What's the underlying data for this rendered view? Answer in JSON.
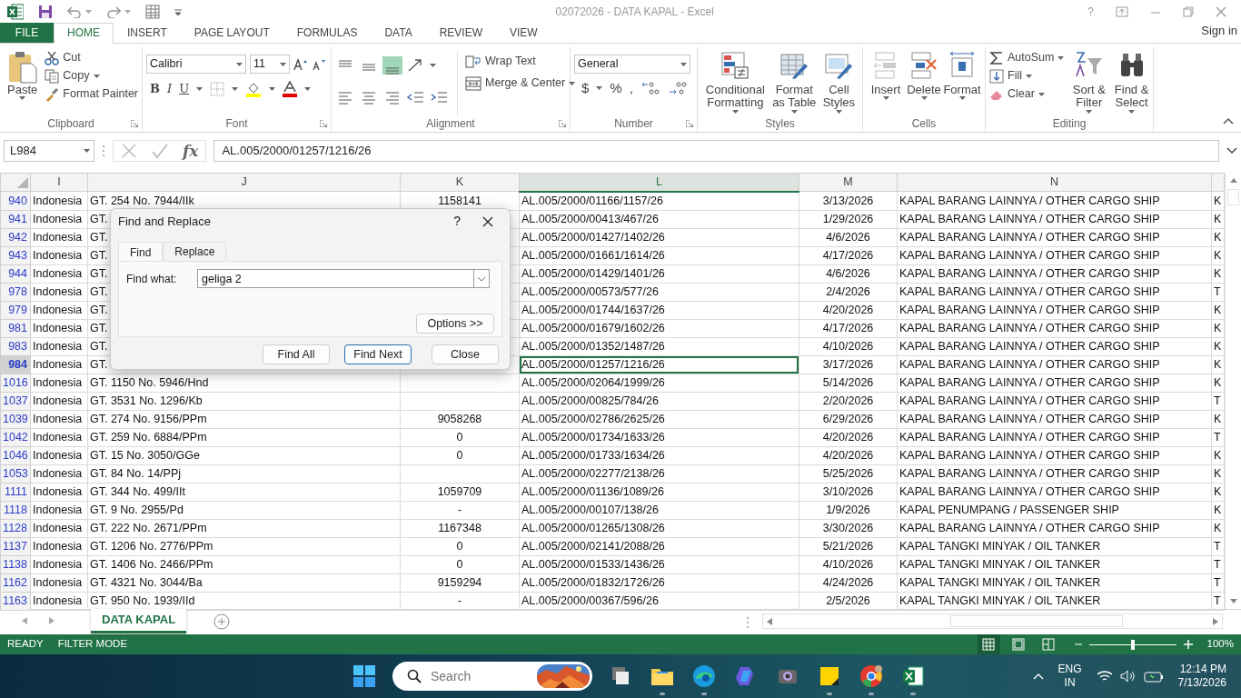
{
  "window": {
    "title": "02072026 - DATA KAPAL - Excel",
    "help": "?"
  },
  "ribbon_tabs": [
    {
      "label": "FILE",
      "kind": "file",
      "selected": false
    },
    {
      "label": "HOME",
      "kind": "tab",
      "selected": true
    },
    {
      "label": "INSERT",
      "kind": "tab",
      "selected": false
    },
    {
      "label": "PAGE LAYOUT",
      "kind": "tab",
      "selected": false
    },
    {
      "label": "FORMULAS",
      "kind": "tab",
      "selected": false
    },
    {
      "label": "DATA",
      "kind": "tab",
      "selected": false
    },
    {
      "label": "REVIEW",
      "kind": "tab",
      "selected": false
    },
    {
      "label": "VIEW",
      "kind": "tab",
      "selected": false
    }
  ],
  "account": "Sign in",
  "ribbon": {
    "groups": [
      {
        "label": "Clipboard",
        "items": [
          {
            "label": "Paste"
          },
          {
            "label": "Cut"
          },
          {
            "label": "Copy"
          },
          {
            "label": "Format Painter"
          }
        ]
      },
      {
        "label": "Font",
        "font": "Calibri",
        "size": "11",
        "styles": [
          "B",
          "I",
          "U"
        ]
      },
      {
        "label": "Alignment",
        "aligns": [
          {
            "selected": false
          },
          {
            "selected": false
          },
          {
            "selected": true
          }
        ],
        "items": [
          {
            "label": "Wrap Text"
          },
          {
            "label": "Merge & Center"
          }
        ]
      },
      {
        "label": "Number",
        "format": "General",
        "symbols": [
          "$",
          "%",
          ","
        ]
      },
      {
        "label": "Styles",
        "items": [
          {
            "label": "Conditional Formatting"
          },
          {
            "label": "Format as Table"
          },
          {
            "label": "Cell Styles"
          }
        ]
      },
      {
        "label": "Cells",
        "items": [
          {
            "label": "Insert"
          },
          {
            "label": "Delete"
          },
          {
            "label": "Format"
          }
        ]
      },
      {
        "label": "Editing",
        "items": [
          {
            "label": "AutoSum"
          },
          {
            "label": "Fill"
          },
          {
            "label": "Clear"
          },
          {
            "label": "Sort & Filter"
          },
          {
            "label": "Find & Select"
          }
        ]
      }
    ]
  },
  "formula_bar": {
    "name_box": "L984",
    "fx": "fx",
    "formula": "AL.005/2000/01257/1216/26"
  },
  "columns": [
    {
      "label": "I",
      "selected": false
    },
    {
      "label": "J",
      "selected": false
    },
    {
      "label": "K",
      "selected": false
    },
    {
      "label": "L",
      "selected": true
    },
    {
      "label": "M",
      "selected": false
    },
    {
      "label": "N",
      "selected": false
    }
  ],
  "rows": [
    {
      "row": "940",
      "i": "Indonesia",
      "j": "GT. 254 No. 7944/IIk",
      "k": "1158141",
      "l": "AL.005/2000/01166/1157/26",
      "m": "3/13/2026",
      "n": "KAPAL BARANG LAINNYA / OTHER CARGO SHIP",
      "o": "K",
      "selected": false
    },
    {
      "row": "941",
      "i": "Indonesia",
      "j": "GT.",
      "l": "AL.005/2000/00413/467/26",
      "m": "1/29/2026",
      "n": "KAPAL BARANG LAINNYA / OTHER CARGO SHIP",
      "o": "K",
      "selected": false
    },
    {
      "row": "942",
      "i": "Indonesia",
      "j": "GT.",
      "l": "AL.005/2000/01427/1402/26",
      "m": "4/6/2026",
      "n": "KAPAL BARANG LAINNYA / OTHER CARGO SHIP",
      "o": "K",
      "selected": false
    },
    {
      "row": "943",
      "i": "Indonesia",
      "j": "GT.",
      "l": "AL.005/2000/01661/1614/26",
      "m": "4/17/2026",
      "n": "KAPAL BARANG LAINNYA / OTHER CARGO SHIP",
      "o": "K",
      "selected": false
    },
    {
      "row": "944",
      "i": "Indonesia",
      "j": "GT.",
      "l": "AL.005/2000/01429/1401/26",
      "m": "4/6/2026",
      "n": "KAPAL BARANG LAINNYA / OTHER CARGO SHIP",
      "o": "K",
      "selected": false
    },
    {
      "row": "978",
      "i": "Indonesia",
      "j": "GT.",
      "l": "AL.005/2000/00573/577/26",
      "m": "2/4/2026",
      "n": "KAPAL BARANG LAINNYA / OTHER CARGO SHIP",
      "o": "T",
      "selected": false
    },
    {
      "row": "979",
      "i": "Indonesia",
      "j": "GT.",
      "l": "AL.005/2000/01744/1637/26",
      "m": "4/20/2026",
      "n": "KAPAL BARANG LAINNYA / OTHER CARGO SHIP",
      "o": "K",
      "selected": false
    },
    {
      "row": "981",
      "i": "Indonesia",
      "j": "GT.",
      "l": "AL.005/2000/01679/1602/26",
      "m": "4/17/2026",
      "n": "KAPAL BARANG LAINNYA / OTHER CARGO SHIP",
      "o": "K",
      "selected": false
    },
    {
      "row": "983",
      "i": "Indonesia",
      "j": "GT.",
      "l": "AL.005/2000/01352/1487/26",
      "m": "4/10/2026",
      "n": "KAPAL BARANG LAINNYA / OTHER CARGO SHIP",
      "o": "K",
      "selected": false
    },
    {
      "row": "984",
      "i": "Indonesia",
      "j": "GT.",
      "l": "AL.005/2000/01257/1216/26",
      "m": "3/17/2026",
      "n": "KAPAL BARANG LAINNYA / OTHER CARGO SHIP",
      "o": "K",
      "selected": true
    },
    {
      "row": "1016",
      "i": "Indonesia",
      "j": "GT. 1150 No. 5946/Hnd",
      "l": "AL.005/2000/02064/1999/26",
      "m": "5/14/2026",
      "n": "KAPAL BARANG LAINNYA / OTHER CARGO SHIP",
      "o": "K",
      "selected": false
    },
    {
      "row": "1037",
      "i": "Indonesia",
      "j": "GT. 3531 No. 1296/Kb",
      "l": "AL.005/2000/00825/784/26",
      "m": "2/20/2026",
      "n": "KAPAL BARANG LAINNYA / OTHER CARGO SHIP",
      "o": "T",
      "selected": false
    },
    {
      "row": "1039",
      "i": "Indonesia",
      "j": "GT. 274 No. 9156/PPm",
      "k": "9058268",
      "l": "AL.005/2000/02786/2625/26",
      "m": "6/29/2026",
      "n": "KAPAL BARANG LAINNYA / OTHER CARGO SHIP",
      "o": "K",
      "selected": false
    },
    {
      "row": "1042",
      "i": "Indonesia",
      "j": "GT. 259 No. 6884/PPm",
      "k": "0",
      "l": "AL.005/2000/01734/1633/26",
      "m": "4/20/2026",
      "n": "KAPAL BARANG LAINNYA / OTHER CARGO SHIP",
      "o": "T",
      "selected": false
    },
    {
      "row": "1046",
      "i": "Indonesia",
      "j": "GT. 15 No. 3050/GGe",
      "k": "0",
      "l": "AL.005/2000/01733/1634/26",
      "m": "4/20/2026",
      "n": "KAPAL BARANG LAINNYA / OTHER CARGO SHIP",
      "o": "K",
      "selected": false
    },
    {
      "row": "1053",
      "i": "Indonesia",
      "j": "GT. 84 No. 14/PPj",
      "l": "AL.005/2000/02277/2138/26",
      "m": "5/25/2026",
      "n": "KAPAL BARANG LAINNYA / OTHER CARGO SHIP",
      "o": "K",
      "selected": false
    },
    {
      "row": "1111",
      "i": "Indonesia",
      "j": "GT. 344 No. 499/IIt",
      "k": "1059709",
      "l": "AL.005/2000/01136/1089/26",
      "m": "3/10/2026",
      "n": "KAPAL BARANG LAINNYA / OTHER CARGO SHIP",
      "o": "K",
      "selected": false
    },
    {
      "row": "1118",
      "i": "Indonesia",
      "j": "GT. 9 No. 2955/Pd",
      "k": "-",
      "l": "AL.005/2000/00107/138/26",
      "m": "1/9/2026",
      "n": "KAPAL PENUMPANG / PASSENGER SHIP",
      "o": "K",
      "selected": false
    },
    {
      "row": "1128",
      "i": "Indonesia",
      "j": "GT. 222 No. 2671/PPm",
      "k": "1167348",
      "l": "AL.005/2000/01265/1308/26",
      "m": "3/30/2026",
      "n": "KAPAL BARANG LAINNYA / OTHER CARGO SHIP",
      "o": "K",
      "selected": false
    },
    {
      "row": "1137",
      "i": "Indonesia",
      "j": "GT. 1206 No. 2776/PPm",
      "k": "0",
      "l": "AL.005/2000/02141/2088/26",
      "m": "5/21/2026",
      "n": "KAPAL TANGKI MINYAK / OIL TANKER",
      "o": "T",
      "selected": false
    },
    {
      "row": "1138",
      "i": "Indonesia",
      "j": "GT. 1406 No. 2466/PPm",
      "k": "0",
      "l": "AL.005/2000/01533/1436/26",
      "m": "4/10/2026",
      "n": "KAPAL TANGKI MINYAK / OIL TANKER",
      "o": "T",
      "selected": false
    },
    {
      "row": "1162",
      "i": "Indonesia",
      "j": "GT. 4321 No. 3044/Ba",
      "k": "9159294",
      "l": "AL.005/2000/01832/1726/26",
      "m": "4/24/2026",
      "n": "KAPAL TANGKI MINYAK / OIL TANKER",
      "o": "T",
      "selected": false
    },
    {
      "row": "1163",
      "i": "Indonesia",
      "j": "GT. 950 No. 1939/IId",
      "k": "-",
      "l": "AL.005/2000/00367/596/26",
      "m": "2/5/2026",
      "n": "KAPAL TANGKI MINYAK / OIL TANKER",
      "o": "T",
      "selected": false
    }
  ],
  "dialog": {
    "title": "Find and Replace",
    "help": "?",
    "tabs": [
      {
        "label": "Find",
        "selected": true
      },
      {
        "label": "Replace",
        "selected": false
      }
    ],
    "find_label": "Find what:",
    "find_value": "geliga 2",
    "options": "Options >>",
    "buttons": [
      {
        "label": "Find All",
        "default": false
      },
      {
        "label": "Find Next",
        "default": true
      },
      {
        "label": "Close",
        "default": false
      }
    ]
  },
  "sheet_tabs": [
    {
      "label": "DATA KAPAL",
      "selected": true
    }
  ],
  "status_bar": {
    "mode": "READY",
    "filter": "FILTER MODE",
    "views": [
      {
        "selected": true
      },
      {
        "selected": false
      },
      {
        "selected": false
      }
    ],
    "zoom": {
      "level": 0.5,
      "reading": "100%"
    }
  },
  "taskbar": {
    "search": {
      "placeholder": "Search"
    },
    "apps": [
      {
        "running": false
      },
      {
        "running": false
      },
      {
        "running": true
      },
      {
        "running": true
      },
      {
        "running": false
      },
      {
        "running": false
      },
      {
        "running": true
      },
      {
        "running": true
      },
      {
        "running": true
      }
    ],
    "language": "ENG",
    "region": "IN",
    "time": "12:14 PM",
    "date": "7/13/2026"
  }
}
